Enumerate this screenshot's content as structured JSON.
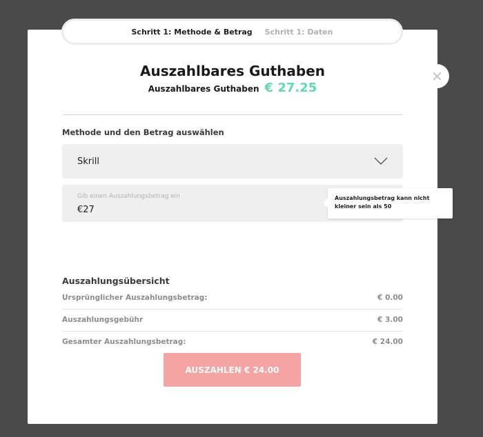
{
  "stepper": {
    "step1_label": "Schritt 1: Methode & Betrag",
    "step2_label": "Schritt 1: Daten"
  },
  "header": {
    "title": "Auszahlbares Guthaben",
    "balance_label": "Auszahlbares Guthaben",
    "balance_value": "€ 27.25"
  },
  "method": {
    "section_label": "Methode und den Betrag auswählen",
    "selected": "Skrill"
  },
  "amount": {
    "label": "Gib einen Auszahlungsbetrag ein",
    "value": "€27"
  },
  "tooltip": {
    "text": "Auszahlungsbetrag kann nicht kleiner sein als 50"
  },
  "summary": {
    "title": "Auszahlungsübersicht",
    "rows": [
      {
        "label": "Ursprünglicher Auszahlungsbetrag:",
        "value": "€ 0.00"
      },
      {
        "label": "Auszahlungsgebühr",
        "value": "€ 3.00"
      },
      {
        "label": "Gesamter Auszahlungsbetrag:",
        "value": "€ 24.00"
      }
    ]
  },
  "payout_button": {
    "label": "AUSZAHLEN € 24.00"
  },
  "colors": {
    "background": "#4a4a4a",
    "balance_accent": "#5fd8b7",
    "payout_button": "#f6a3a3",
    "field_background": "#efefef"
  },
  "icons": {
    "close": "close-icon",
    "dropdown": "chevron-down-icon"
  }
}
